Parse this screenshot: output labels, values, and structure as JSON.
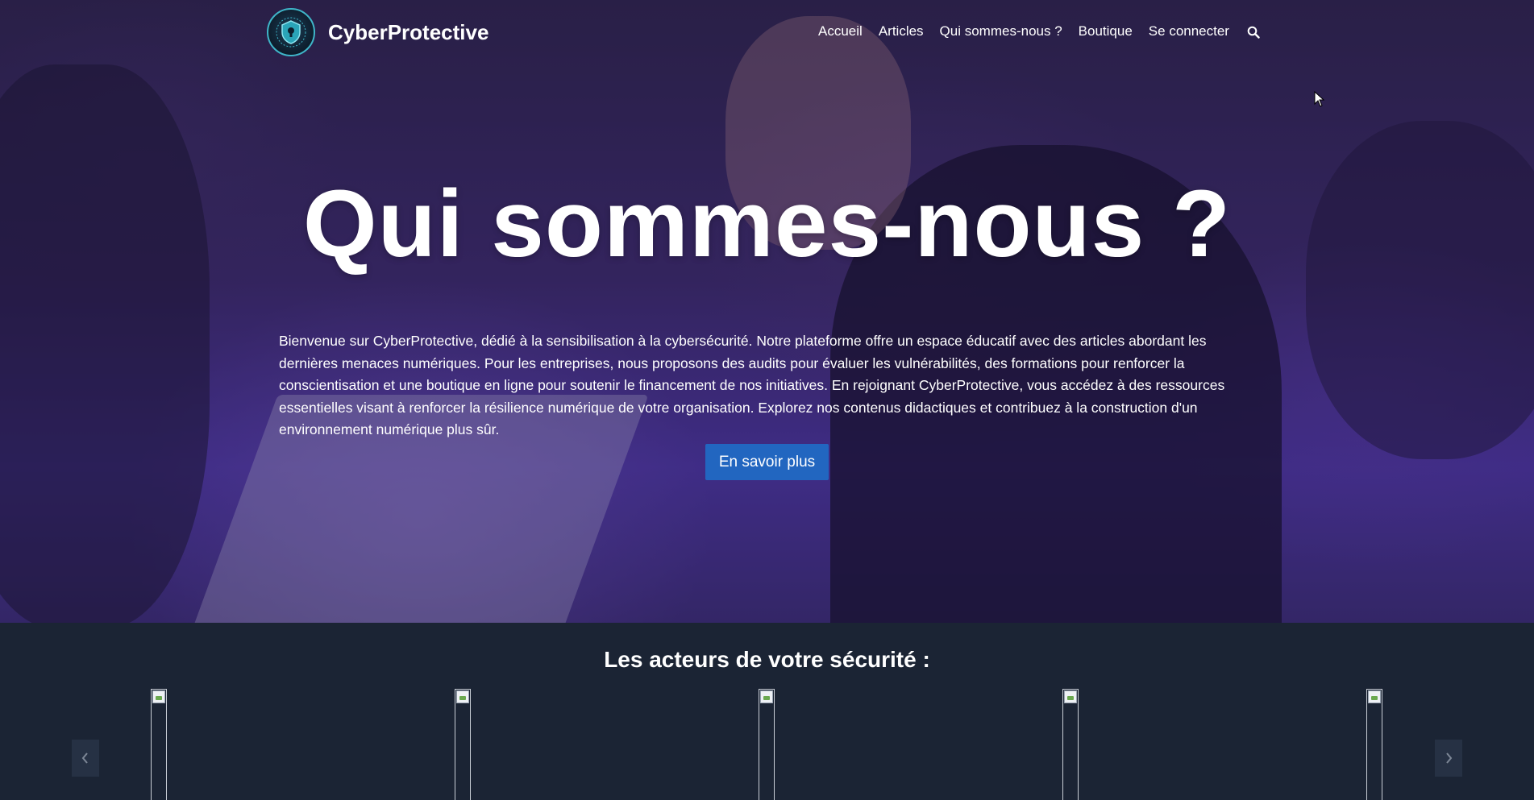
{
  "brand": {
    "name": "CyberProtective",
    "logo_icon": "shield-logo-icon"
  },
  "nav": {
    "items": [
      {
        "label": "Accueil"
      },
      {
        "label": "Articles"
      },
      {
        "label": "Qui sommes-nous ?"
      },
      {
        "label": "Boutique"
      },
      {
        "label": "Se connecter"
      }
    ],
    "search_icon": "search-icon"
  },
  "hero": {
    "title": "Qui sommes-nous ?",
    "text": "Bienvenue sur CyberProtective, dédié à la sensibilisation à la cybersécurité. Notre plateforme offre un espace éducatif avec des articles abordant les dernières menaces numériques. Pour les entreprises, nous proposons des audits pour évaluer les vulnérabilités, des formations pour renforcer la conscientisation et une boutique en ligne pour soutenir le financement de nos initiatives. En rejoignant CyberProtective, vous accédez à des ressources essentielles visant à renforcer la résilience numérique de votre organisation. Explorez nos contenus didactiques et contribuez à la construction d'un environnement numérique plus sûr.",
    "cta_label": "En savoir plus"
  },
  "team": {
    "title": "Les acteurs de votre sécurité :",
    "prev_icon": "chevron-left-icon",
    "next_icon": "chevron-right-icon",
    "cards": [
      {
        "image": "broken-image-icon"
      },
      {
        "image": "broken-image-icon"
      },
      {
        "image": "broken-image-icon"
      },
      {
        "image": "broken-image-icon"
      },
      {
        "image": "broken-image-icon"
      }
    ]
  },
  "colors": {
    "button": "#2266c0",
    "section_bg": "#1b2434",
    "logo_ring": "#3fb6c9"
  }
}
